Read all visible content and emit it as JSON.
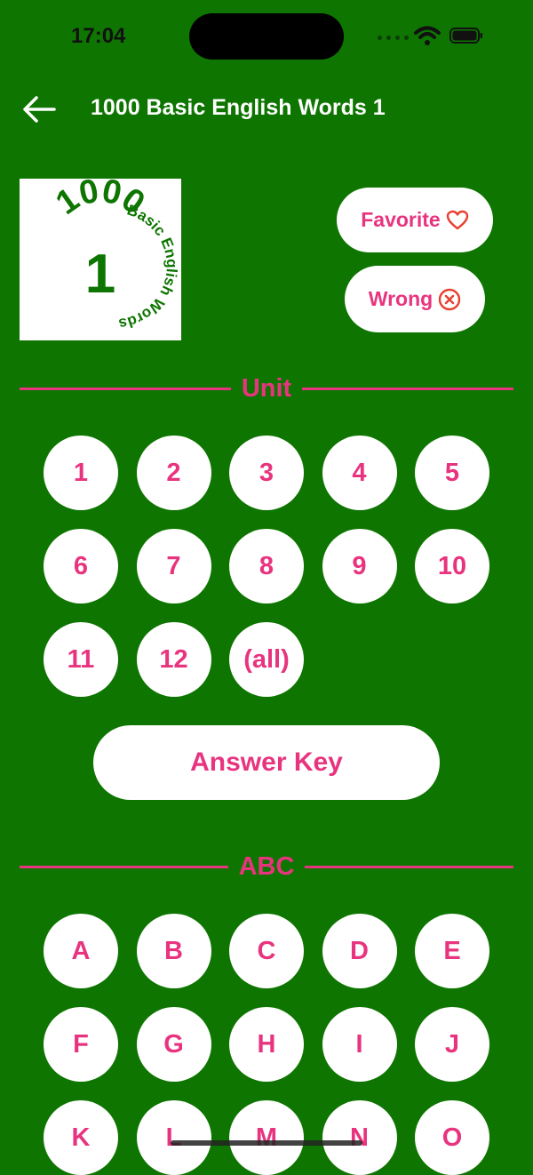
{
  "status_bar": {
    "time": "17:04"
  },
  "header": {
    "title": "1000 Basic English Words 1",
    "back_icon": "arrow-left-icon"
  },
  "logo": {
    "number_text": "1000",
    "center_text": "1",
    "arc_text": "Basic English Words",
    "color": "#0e7500"
  },
  "buttons": {
    "favorite": {
      "label": "Favorite",
      "icon": "heart-icon"
    },
    "wrong": {
      "label": "Wrong",
      "icon": "x-circle-icon"
    }
  },
  "unit_section": {
    "heading": "Unit",
    "items": [
      "1",
      "2",
      "3",
      "4",
      "5",
      "6",
      "7",
      "8",
      "9",
      "10",
      "11",
      "12",
      "(all)"
    ]
  },
  "answer_key": {
    "label": "Answer Key"
  },
  "abc_section": {
    "heading": "ABC",
    "items": [
      "A",
      "B",
      "C",
      "D",
      "E",
      "F",
      "G",
      "H",
      "I",
      "J",
      "K",
      "L",
      "M",
      "N",
      "O"
    ]
  },
  "colors": {
    "background": "#0e7500",
    "accent": "#e8347f",
    "icon_red": "#e8402f"
  }
}
